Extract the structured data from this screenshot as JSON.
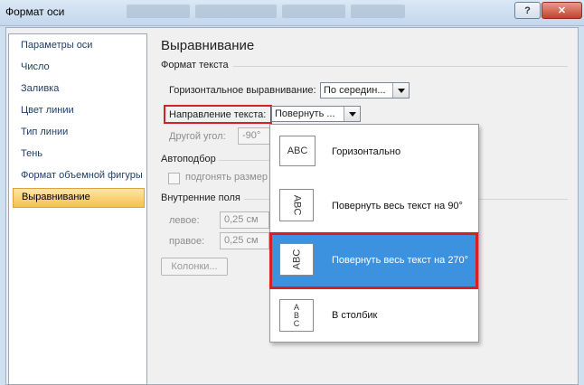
{
  "window": {
    "title": "Формат оси",
    "help_label": "?",
    "close_label": "✕"
  },
  "sidebar": {
    "items": [
      {
        "label": "Параметры оси"
      },
      {
        "label": "Число"
      },
      {
        "label": "Заливка"
      },
      {
        "label": "Цвет линии"
      },
      {
        "label": "Тип линии"
      },
      {
        "label": "Тень"
      },
      {
        "label": "Формат объемной фигуры"
      },
      {
        "label": "Выравнивание"
      }
    ],
    "active_index": 7
  },
  "panel": {
    "title": "Выравнивание",
    "text_format_section": "Формат текста",
    "horizontal_alignment": {
      "label": "Горизонтальное выравнивание:",
      "value": "По середин..."
    },
    "text_direction": {
      "label": "Направление текста:",
      "value": "Повернуть ..."
    },
    "other_angle": {
      "label": "Другой угол:",
      "value": "-90°"
    },
    "autofit_section": "Автоподбор",
    "autofit_checkbox": {
      "label": "подгонять размер",
      "checked": false
    },
    "margins_section": "Внутренние поля",
    "margin_left": {
      "label": "левое:",
      "value": "0,25 см"
    },
    "margin_right": {
      "label": "правое:",
      "value": "0,25 см"
    },
    "columns_button": "Колонки..."
  },
  "dropdown": {
    "options": [
      {
        "label": "Горизонтально",
        "icon": "abc-horizontal-icon",
        "icon_text": "ABC"
      },
      {
        "label": "Повернуть весь текст на 90°",
        "icon": "abc-rotate-90-icon",
        "icon_text": "ABC"
      },
      {
        "label": "Повернуть весь текст на 270°",
        "icon": "abc-rotate-270-icon",
        "icon_text": "ABC"
      },
      {
        "label": "В столбик",
        "icon": "abc-stacked-icon",
        "icon_text": [
          "A",
          "B",
          "C"
        ]
      }
    ],
    "selected_index": 2
  },
  "colors": {
    "selection": "#3d92e0",
    "highlight": "#d61f26",
    "active_sidebar": "#f7c04c"
  }
}
